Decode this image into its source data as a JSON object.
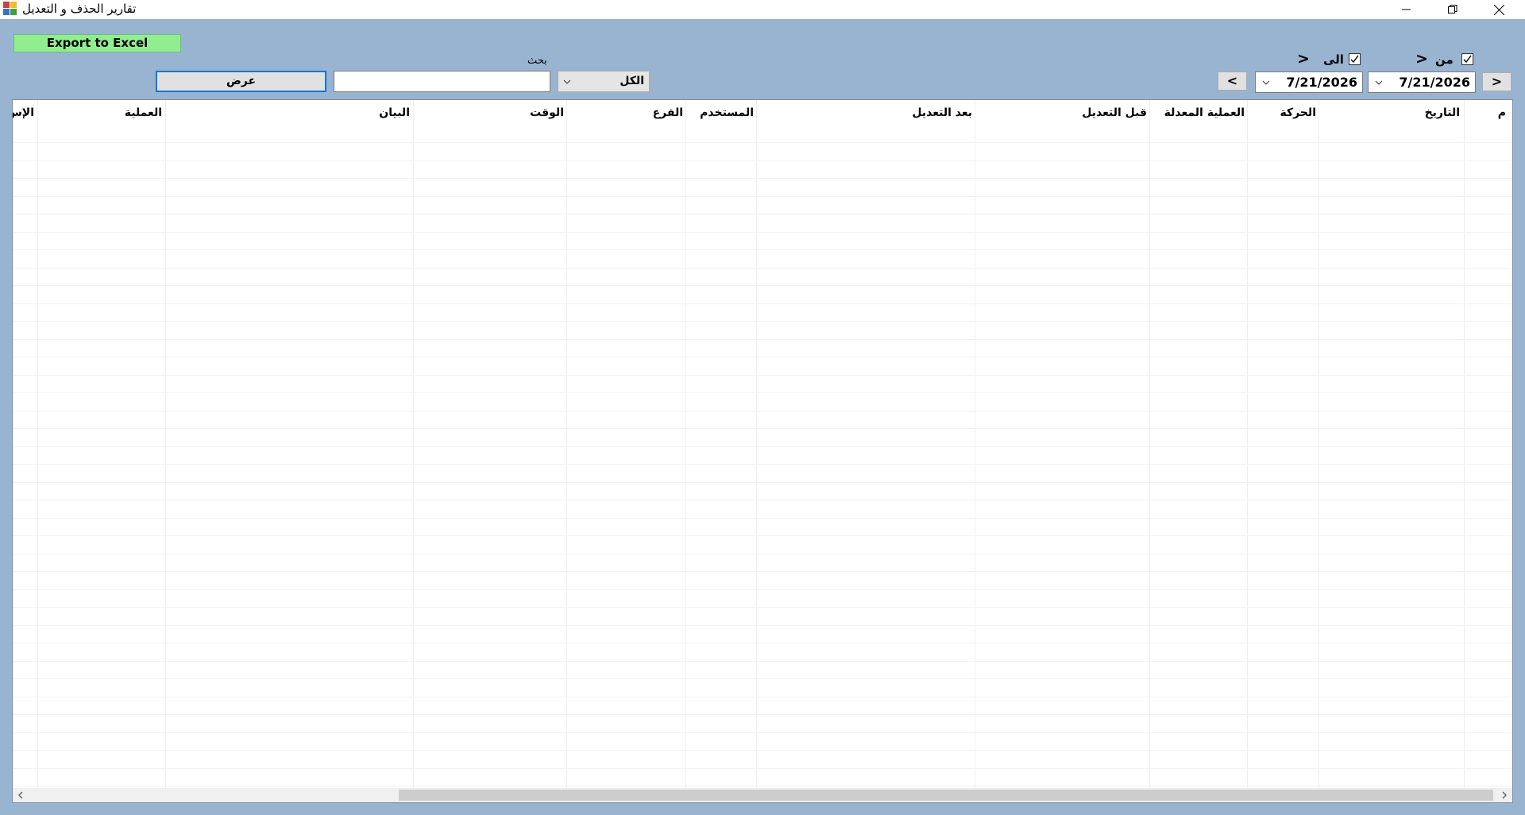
{
  "window": {
    "title": "تقارير الحذف و التعديل",
    "icon": "report-app-icon",
    "controls": [
      "minimize-icon",
      "restore-icon",
      "close-icon"
    ]
  },
  "toolbar": {
    "export_label": "Export to Excel",
    "export_color": "#90ee90"
  },
  "filters": {
    "from_label": "من",
    "to_label": "الى",
    "from_checked": true,
    "to_checked": true,
    "from_arrow": ">",
    "to_arrow": ">",
    "from_date": "7/21/2026",
    "to_date": "7/21/2026",
    "from_nav": ">",
    "to_nav": "<",
    "search_label": "بحث",
    "search_value": "",
    "scope_value": "الكل",
    "show_label": "عرض"
  },
  "grid": {
    "columns": [
      "م",
      "التاريخ",
      "الحركة",
      "العملية المعدلة",
      "قبل التعديل",
      "بعد التعديل",
      "المستخدم",
      "الفرع",
      "الوقت",
      "البيان",
      "العملية",
      "الإس"
    ],
    "rows": []
  },
  "colors": {
    "background": "#99b4d1",
    "focus_border": "#0078d7"
  }
}
